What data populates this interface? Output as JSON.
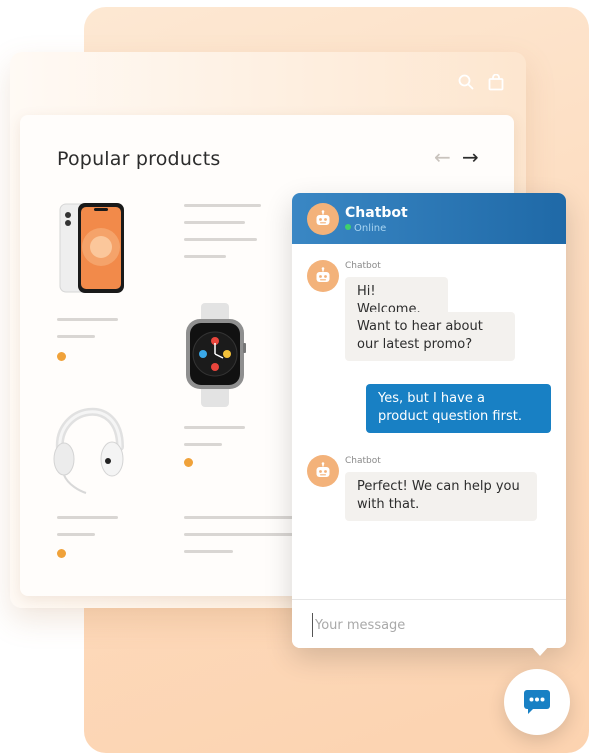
{
  "store": {
    "title": "Popular products",
    "header_icons": [
      "search-icon",
      "shopping-bag-icon"
    ],
    "nav": {
      "prev_label": "←",
      "next_label": "→"
    },
    "products": [
      {
        "name": "iphone-product-image"
      },
      {
        "name": "watch-product-image"
      },
      {
        "name": "headphones-product-image"
      }
    ]
  },
  "chat": {
    "title": "Chatbot",
    "status": "Online",
    "messages": [
      {
        "sender": "Chatbot",
        "lines": [
          "Hi! Welcome.",
          "Want to hear about our latest promo?"
        ]
      },
      {
        "sender": "user",
        "lines": [
          "Yes, but I have a product question first."
        ]
      },
      {
        "sender": "Chatbot",
        "lines": [
          "Perfect! We can help you with that."
        ]
      }
    ],
    "input_placeholder": "Your message"
  },
  "colors": {
    "accent_blue": "#1880c4",
    "header_blue": "#2a78b8",
    "peach": "#fddcc0",
    "orange_dot": "#f0a23a",
    "avatar": "#f3b27a",
    "online": "#3fd06b"
  }
}
